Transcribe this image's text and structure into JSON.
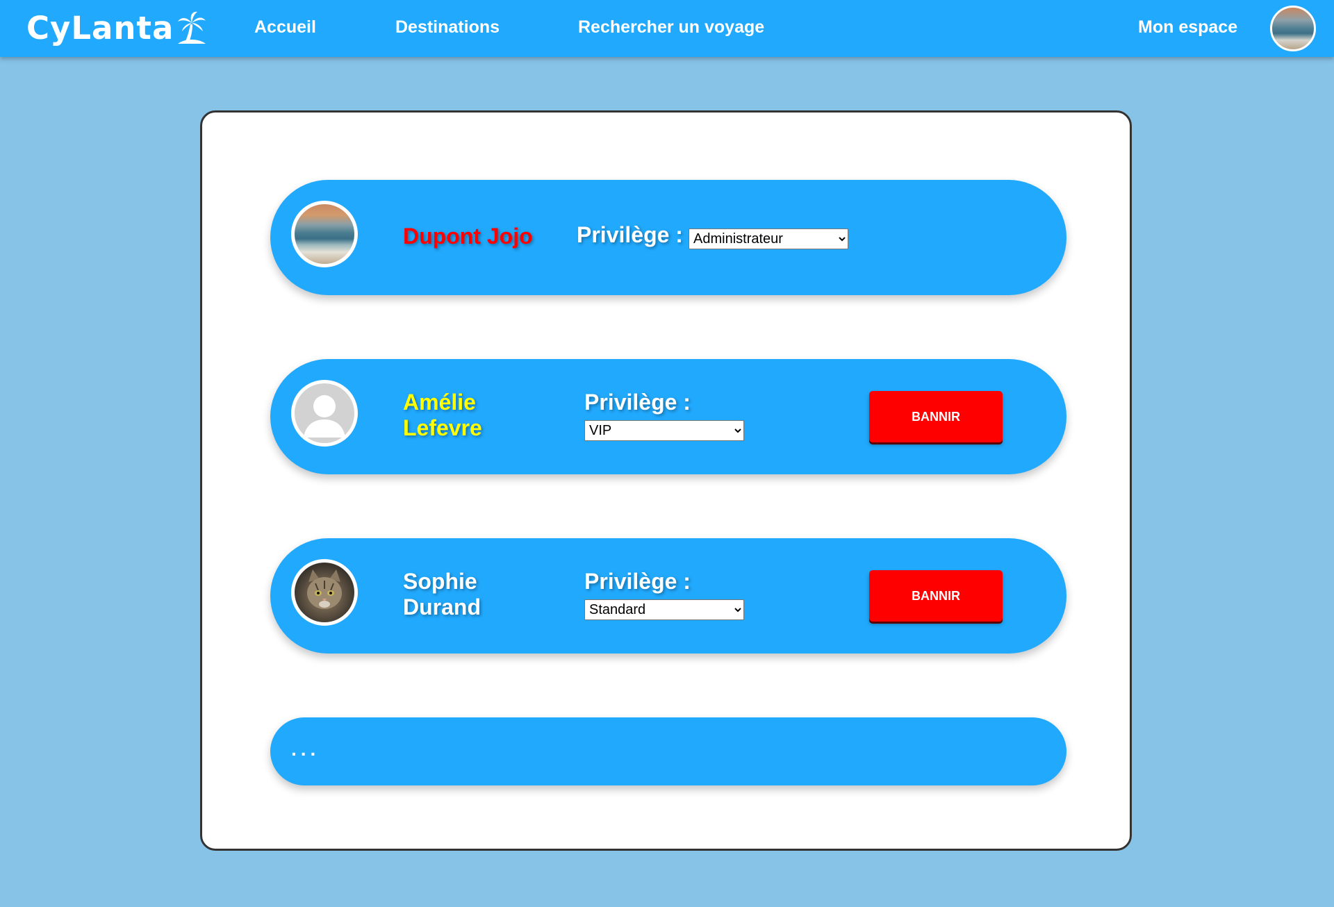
{
  "header": {
    "logo": "CyLanta",
    "nav": {
      "home": "Accueil",
      "destinations": "Destinations",
      "search": "Rechercher un voyage",
      "account": "Mon espace"
    }
  },
  "users": [
    {
      "name": "Dupont Jojo",
      "name_color": "#ff0000",
      "privilege_label": "Privilège :",
      "privilege": "Administrateur",
      "avatar": "beach-photo"
    },
    {
      "first_name": "Amélie",
      "last_name": "Lefevre",
      "name_color": "#ffff00",
      "privilege_label": "Privilège :",
      "privilege": "VIP",
      "avatar": "default-user",
      "ban_label": "BANNIR"
    },
    {
      "first_name": "Sophie",
      "last_name": "Durand",
      "name_color": "#ffffff",
      "privilege_label": "Privilège :",
      "privilege": "Standard",
      "avatar": "cat-photo",
      "ban_label": "BANNIR"
    }
  ],
  "more_indicator": "...",
  "colors": {
    "header_bg": "#21a9fd",
    "page_bg": "#87c2e7",
    "row_bg": "#21a9fd",
    "ban_button": "#ff0000"
  }
}
